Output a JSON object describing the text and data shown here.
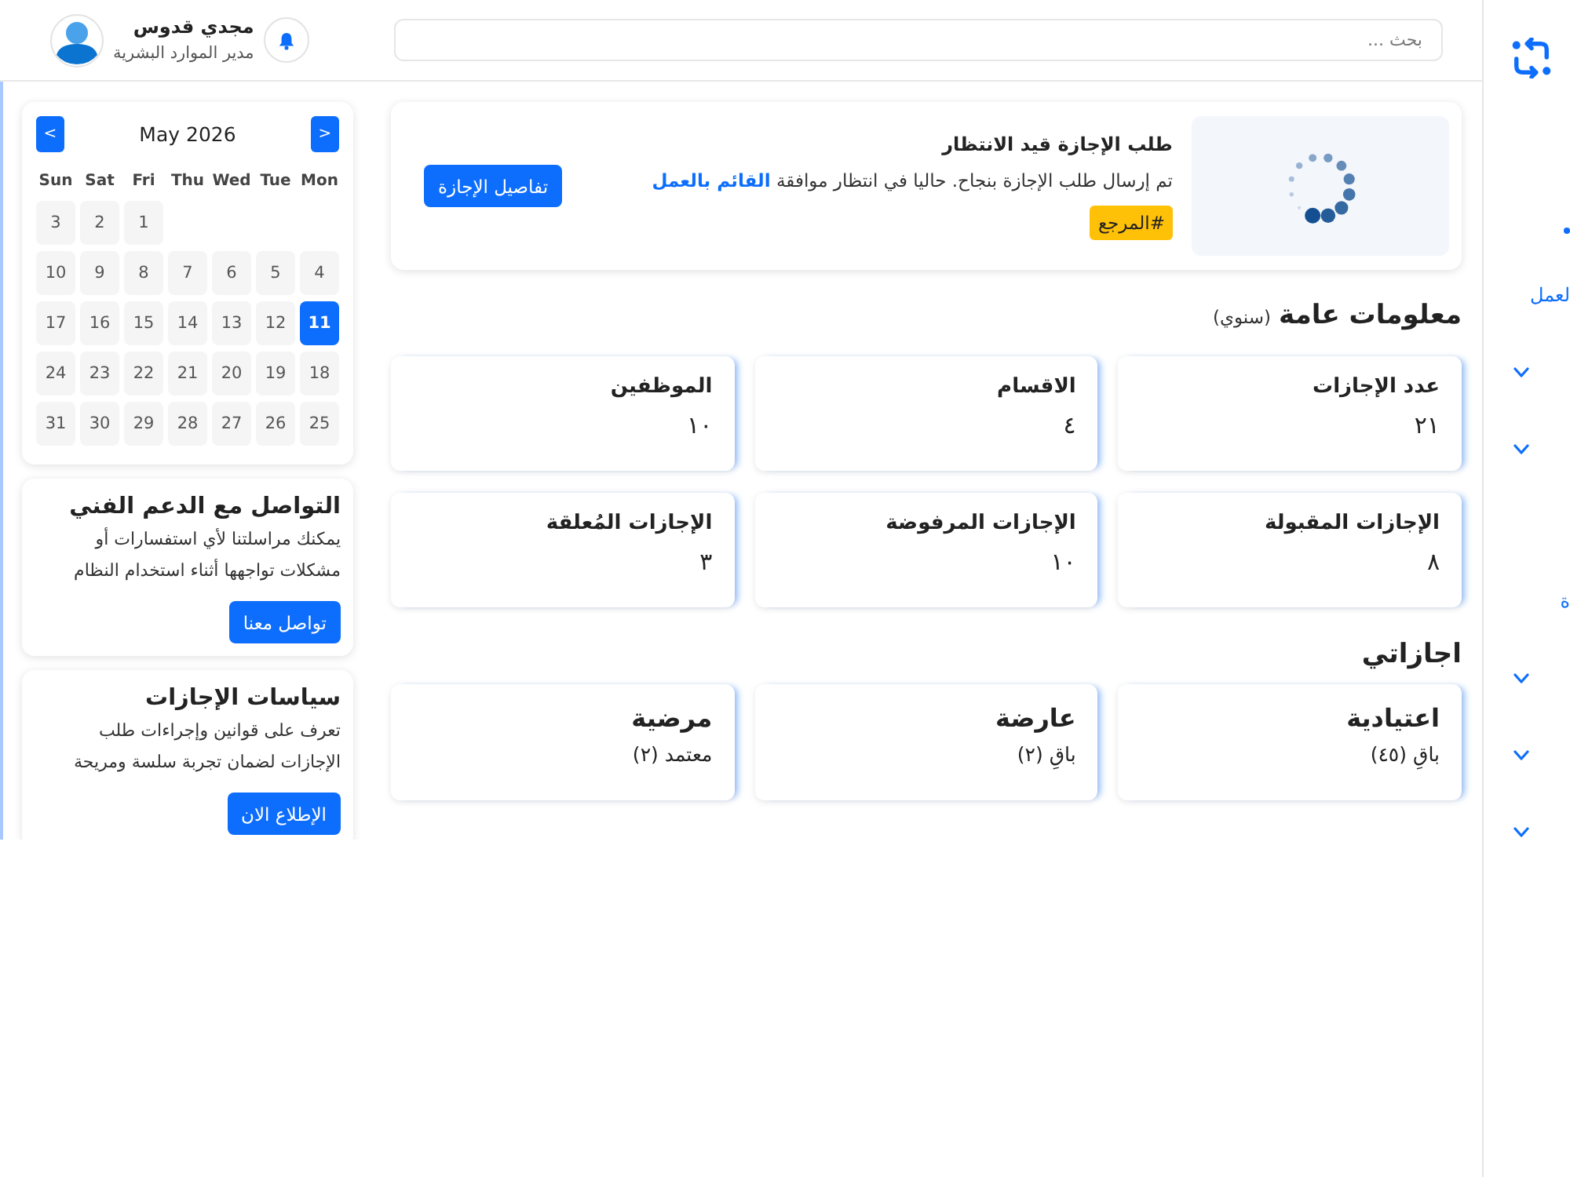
{
  "sidebar": {
    "items": [
      {
        "kind": "dot"
      },
      {
        "kind": "section",
        "label": "لعمل"
      },
      {
        "kind": "group",
        "expanded": false
      },
      {
        "kind": "group",
        "expanded": false
      },
      {
        "kind": "section",
        "label": "ة"
      },
      {
        "kind": "group",
        "expanded": false
      },
      {
        "kind": "group",
        "expanded": false
      },
      {
        "kind": "group",
        "expanded": false
      }
    ]
  },
  "header": {
    "search": {
      "placeholder": "بحث ..."
    },
    "user": {
      "name": "مجدي قدوس",
      "role": "مدير الموارد البشرية"
    }
  },
  "pending": {
    "title": "طلب الإجازة قيد الانتظار",
    "message": "تم إرسال طلب الإجازة بنجاح. حاليا في انتظار موافقة **القائم بالعمل**",
    "badge": "#المرجع",
    "button": "تفاصيل الإجازة"
  },
  "overview": {
    "title": "معلومات عامة",
    "note": "(سنوي)",
    "stats": [
      {
        "label": "عدد الإجازات",
        "value": "٢١"
      },
      {
        "label": "الاقسام",
        "value": "٤"
      },
      {
        "label": "الموظفين",
        "value": "١٠"
      },
      {
        "label": "الإجازات المقبولة",
        "value": "٨"
      },
      {
        "label": "الإجازات المرفوضة",
        "value": "١٠"
      },
      {
        "label": "الإجازات المُعلقة",
        "value": "٣"
      }
    ]
  },
  "my_leaves": {
    "title": "اجازاتي",
    "items": [
      {
        "title": "اعتيادية",
        "detail": "باقِ (٤٥)"
      },
      {
        "title": "عارضة",
        "detail": "باقِ (٢)"
      },
      {
        "title": "مرضية",
        "detail": "معتمد (٢)"
      }
    ]
  },
  "calendar": {
    "month": "May 2026",
    "prev": "<",
    "next": ">",
    "weekdays": [
      "Mon",
      "Tue",
      "Wed",
      "Thu",
      "Fri",
      "Sat",
      "Sun"
    ],
    "weeks": [
      [
        {
          "day": "1",
          "selected": false
        },
        {
          "day": "2",
          "selected": false
        },
        {
          "day": "3",
          "selected": false
        }
      ],
      [
        {
          "day": "4",
          "selected": false
        },
        {
          "day": "5",
          "selected": false
        },
        {
          "day": "6",
          "selected": false
        },
        {
          "day": "7",
          "selected": false
        },
        {
          "day": "8",
          "selected": false
        },
        {
          "day": "9",
          "selected": false
        },
        {
          "day": "10",
          "selected": false
        }
      ],
      [
        {
          "day": "11",
          "selected": true
        },
        {
          "day": "12",
          "selected": false
        },
        {
          "day": "13",
          "selected": false
        },
        {
          "day": "14",
          "selected": false
        },
        {
          "day": "15",
          "selected": false
        },
        {
          "day": "16",
          "selected": false
        },
        {
          "day": "17",
          "selected": false
        }
      ],
      [
        {
          "day": "18",
          "selected": false
        },
        {
          "day": "19",
          "selected": false
        },
        {
          "day": "20",
          "selected": false
        },
        {
          "day": "21",
          "selected": false
        },
        {
          "day": "22",
          "selected": false
        },
        {
          "day": "23",
          "selected": false
        },
        {
          "day": "24",
          "selected": false
        }
      ],
      [
        {
          "day": "25",
          "selected": false
        },
        {
          "day": "26",
          "selected": false
        },
        {
          "day": "27",
          "selected": false
        },
        {
          "day": "28",
          "selected": false
        },
        {
          "day": "29",
          "selected": false
        },
        {
          "day": "30",
          "selected": false
        },
        {
          "day": "31",
          "selected": false
        }
      ]
    ]
  },
  "info_cards": [
    {
      "title": "التواصل مع الدعم الفني",
      "text": "يمكنك مراسلتنا لأي استفسارات أو مشكلات تواجهها أثناء استخدام النظام",
      "button": "تواصل معنا"
    },
    {
      "title": "سياسات الإجازات",
      "text": "تعرف على قوانين وإجراءات طلب الإجازات لضمان تجربة سلسة ومريحة",
      "button": "الإطلاع الان"
    }
  ]
}
